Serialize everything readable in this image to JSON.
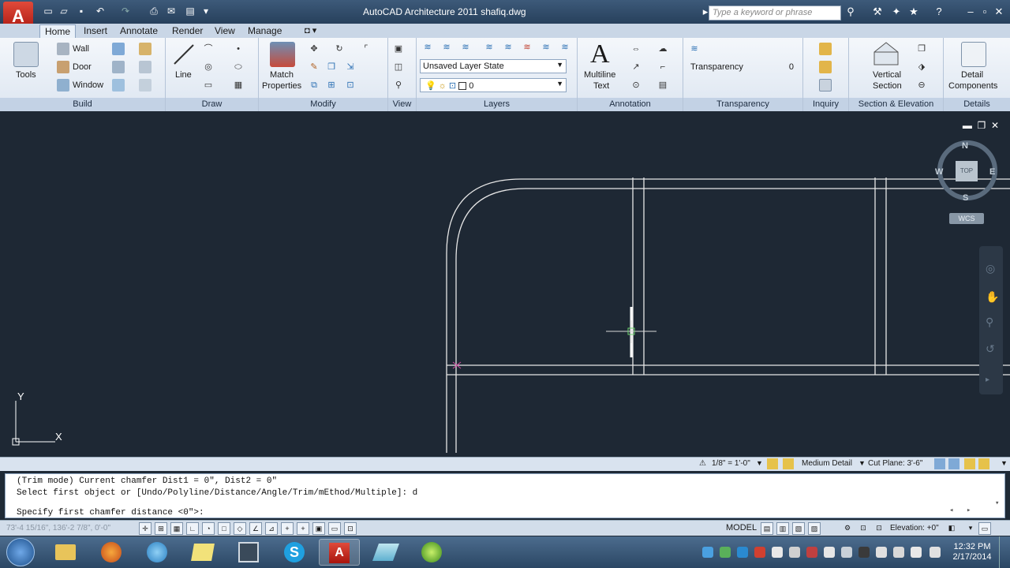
{
  "window": {
    "title": "AutoCAD Architecture 2011    shafiq.dwg",
    "search_placeholder": "Type a keyword or phrase"
  },
  "tabs": [
    "Home",
    "Insert",
    "Annotate",
    "Render",
    "View",
    "Manage"
  ],
  "active_tab": "Home",
  "panels": {
    "build": {
      "title": "Build",
      "tools_label": "Tools",
      "wall": "Wall",
      "door": "Door",
      "window": "Window"
    },
    "draw": {
      "title": "Draw",
      "line_label": "Line"
    },
    "modify": {
      "title": "Modify",
      "match_label": "Match",
      "properties_label": "Properties"
    },
    "view": {
      "title": "View"
    },
    "layers": {
      "title": "Layers",
      "layer_state": "Unsaved Layer State",
      "layer_name": "0"
    },
    "annotation": {
      "title": "Annotation",
      "multiline": "Multiline",
      "text": "Text"
    },
    "transparency": {
      "title": "Transparency",
      "label": "Transparency",
      "value": "0"
    },
    "inquiry": {
      "title": "Inquiry"
    },
    "section": {
      "title": "Section & Elevation",
      "vertical": "Vertical",
      "section": "Section"
    },
    "details": {
      "title": "Details",
      "detail": "Detail",
      "components": "Components"
    }
  },
  "viewcube": {
    "n": "N",
    "s": "S",
    "e": "E",
    "w": "W",
    "top": "TOP",
    "wcs": "WCS"
  },
  "ucs": {
    "x": "X",
    "y": "Y"
  },
  "drawing_status": {
    "scale": "1/8\" = 1'-0\"",
    "detail": "Medium Detail",
    "cut_plane": "Cut Plane: 3'-6\""
  },
  "command": {
    "line1": "(Trim mode) Current chamfer Dist1 = 0\", Dist2 = 0\"",
    "line2": "Select first object or [Undo/Polyline/Distance/Angle/Trim/mEthod/Multiple]: d",
    "line3": "Specify first chamfer distance <0\">:"
  },
  "status": {
    "coords": "73'-4 15/16\", 136'-2 7/8\", 0'-0\"",
    "model": "MODEL",
    "elevation": "Elevation: +0\""
  },
  "clock": {
    "time": "12:32 PM",
    "date": "2/17/2014"
  }
}
